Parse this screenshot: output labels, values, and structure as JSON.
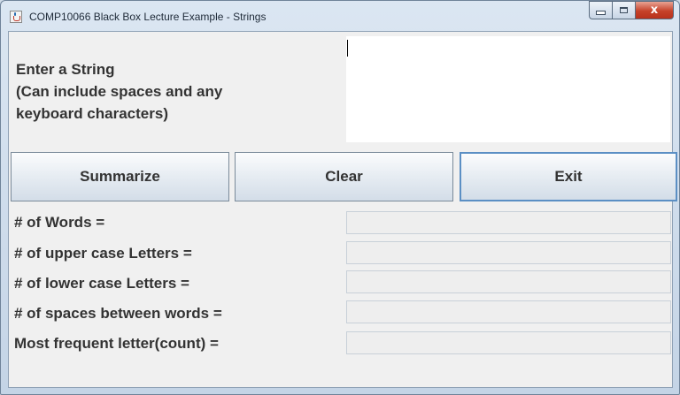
{
  "window": {
    "title": "COMP10066 Black Box Lecture Example - Strings",
    "close_glyph": "x"
  },
  "input_section": {
    "prompt_lines": [
      "Enter a String",
      "(Can include spaces and any",
      "keyboard characters)"
    ],
    "value": ""
  },
  "buttons": {
    "summarize": "Summarize",
    "clear": "Clear",
    "exit": "Exit"
  },
  "results": [
    {
      "label": "# of Words =",
      "value": ""
    },
    {
      "label": "# of upper case Letters =",
      "value": ""
    },
    {
      "label": "# of lower case Letters =",
      "value": ""
    },
    {
      "label": "# of spaces between words =",
      "value": ""
    },
    {
      "label": "Most frequent letter(count) =",
      "value": ""
    }
  ],
  "colors": {
    "title_bar": "#c4d4e6",
    "close_button": "#c6422a",
    "focused_button_border": "#5b8fc4",
    "panel_background": "#f0f0f0"
  },
  "icons": [
    "java-app-icon",
    "minimize-icon",
    "maximize-icon",
    "close-icon"
  ]
}
